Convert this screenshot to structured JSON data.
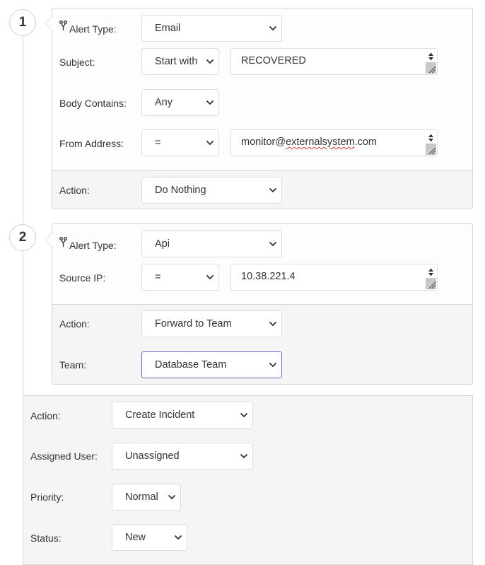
{
  "rules": [
    {
      "step": "1",
      "alert_type": {
        "label": "Alert Type:",
        "value": "Email"
      },
      "subject": {
        "label": "Subject:",
        "operator": "Start with",
        "value": "RECOVERED"
      },
      "body_contains": {
        "label": "Body Contains:",
        "value": "Any"
      },
      "from_address": {
        "label": "From Address:",
        "operator": "=",
        "value_user": "monitor@",
        "value_flagged": "externalsystem",
        "value_tail": ".com"
      },
      "action": {
        "label": "Action:",
        "value": "Do Nothing"
      }
    },
    {
      "step": "2",
      "alert_type": {
        "label": "Alert Type:",
        "value": "Api"
      },
      "source_ip": {
        "label": "Source IP:",
        "operator": "=",
        "value": "10.38.221.4"
      },
      "action": {
        "label": "Action:",
        "value": "Forward to Team"
      },
      "team": {
        "label": "Team:",
        "value": "Database Team"
      }
    }
  ],
  "default": {
    "action": {
      "label": "Action:",
      "value": "Create Incident"
    },
    "assigned_user": {
      "label": "Assigned User:",
      "value": "Unassigned"
    },
    "priority": {
      "label": "Priority:",
      "value": "Normal"
    },
    "status": {
      "label": "Status:",
      "value": "New"
    }
  },
  "icons": {
    "rule_type": "fork-icon",
    "dropdown": "chevron-down-icon",
    "spinner": "spinner-arrows-icon",
    "resize": "resize-grip-icon"
  },
  "colors": {
    "focus_border": "#6a62c9",
    "panel_bg": "#f4f5f4",
    "border": "#d6d6d6",
    "spellcheck": "#d23c3c"
  }
}
